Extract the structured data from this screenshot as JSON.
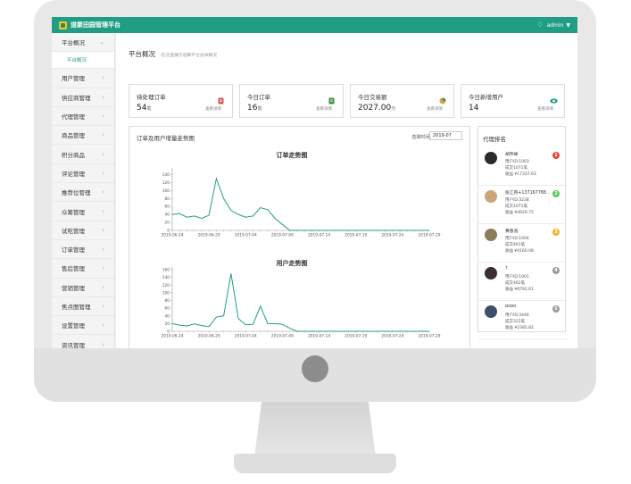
{
  "app": {
    "title": "道聚田园管理平台",
    "user": "admin"
  },
  "sidebar": {
    "items": [
      {
        "label": "平台概况",
        "expanded": true,
        "sub": "平台概况"
      },
      {
        "label": "用户管理"
      },
      {
        "label": "供应商管理"
      },
      {
        "label": "代理管理"
      },
      {
        "label": "商品管理"
      },
      {
        "label": "积分商品"
      },
      {
        "label": "评论管理"
      },
      {
        "label": "推荐位管理"
      },
      {
        "label": "众筹管理"
      },
      {
        "label": "试吃管理"
      },
      {
        "label": "订单管理"
      },
      {
        "label": "售后管理"
      },
      {
        "label": "营销管理"
      },
      {
        "label": "焦点图管理"
      },
      {
        "label": "设置管理"
      },
      {
        "label": "资讯管理"
      }
    ]
  },
  "page": {
    "title": "平台概况",
    "desc": "-在这里展示道聚平台总体概况"
  },
  "stats": [
    {
      "label": "待处理订单",
      "value": "54",
      "unit": "笔",
      "link": "查看详情",
      "icon": "order-icon",
      "color": "#d9534f"
    },
    {
      "label": "今日订单",
      "value": "16",
      "unit": "笔",
      "link": "查看详情",
      "icon": "document-icon",
      "color": "#3c8d3c"
    },
    {
      "label": "今日交易额",
      "value": "2027.00",
      "unit": "元",
      "link": "查看详情",
      "icon": "pie-icon",
      "color": "#e0a52a"
    },
    {
      "label": "今日新增用户",
      "value": "14",
      "unit": "",
      "link": "查看详情",
      "icon": "eye-icon",
      "color": "#1f9e84"
    }
  ],
  "trend": {
    "title": "订单及用户增量走势图",
    "time_label": "选择时间:",
    "time_value": "2019-07"
  },
  "chart_data": [
    {
      "type": "line",
      "title": "订单走势图",
      "x": [
        "2019-06-24",
        "2019-06-25",
        "2019-06-26",
        "2019-06-27",
        "2019-06-28",
        "2019-06-29",
        "2019-06-30",
        "2019-07-01",
        "2019-07-02",
        "2019-07-03",
        "2019-07-04",
        "2019-07-05",
        "2019-07-06",
        "2019-07-07",
        "2019-07-08",
        "2019-07-09",
        "2019-07-10",
        "2019-07-11",
        "2019-07-12",
        "2019-07-13",
        "2019-07-14",
        "2019-07-15",
        "2019-07-16",
        "2019-07-17",
        "2019-07-18",
        "2019-07-19",
        "2019-07-20",
        "2019-07-21",
        "2019-07-22",
        "2019-07-23",
        "2019-07-24",
        "2019-07-25",
        "2019-07-26",
        "2019-07-27",
        "2019-07-28",
        "2019-07-29"
      ],
      "values": [
        40,
        42,
        33,
        36,
        30,
        38,
        130,
        80,
        50,
        40,
        33,
        36,
        57,
        52,
        30,
        15,
        0,
        0,
        0,
        0,
        0,
        0,
        0,
        0,
        0,
        0,
        0,
        0,
        0,
        0,
        0,
        0,
        0,
        0,
        0,
        0
      ],
      "xticks": [
        "2019-06-24",
        "2019-06-29",
        "2019-07-04",
        "2019-07-09",
        "2019-07-14",
        "2019-07-19",
        "2019-07-24",
        "2019-07-29"
      ],
      "yticks": [
        0,
        20,
        40,
        60,
        80,
        100,
        120,
        140
      ],
      "ylim": [
        0,
        150
      ],
      "color": "#1f9e84"
    },
    {
      "type": "line",
      "title": "用户走势图",
      "x": [
        "2019-06-24",
        "2019-06-25",
        "2019-06-26",
        "2019-06-27",
        "2019-06-28",
        "2019-06-29",
        "2019-06-30",
        "2019-07-01",
        "2019-07-02",
        "2019-07-03",
        "2019-07-04",
        "2019-07-05",
        "2019-07-06",
        "2019-07-07",
        "2019-07-08",
        "2019-07-09",
        "2019-07-10",
        "2019-07-11",
        "2019-07-12",
        "2019-07-13",
        "2019-07-14",
        "2019-07-15",
        "2019-07-16",
        "2019-07-17",
        "2019-07-18",
        "2019-07-19",
        "2019-07-20",
        "2019-07-21",
        "2019-07-22",
        "2019-07-23",
        "2019-07-24",
        "2019-07-25",
        "2019-07-26",
        "2019-07-27",
        "2019-07-28",
        "2019-07-29"
      ],
      "values": [
        20,
        16,
        14,
        19,
        15,
        12,
        37,
        40,
        150,
        33,
        17,
        18,
        65,
        20,
        20,
        18,
        8,
        0,
        0,
        0,
        0,
        0,
        0,
        0,
        0,
        0,
        0,
        0,
        0,
        0,
        0,
        0,
        0,
        0,
        0,
        0
      ],
      "xticks": [
        "2019-06-24",
        "2019-06-29",
        "2019-07-04",
        "2019-07-09",
        "2019-07-14",
        "2019-07-19",
        "2019-07-24",
        "2019-07-29"
      ],
      "yticks": [
        0,
        20,
        40,
        60,
        80,
        100,
        120,
        140,
        160
      ],
      "ylim": [
        0,
        160
      ],
      "color": "#1f9e84"
    }
  ],
  "ranking": {
    "title": "代理排名",
    "items": [
      {
        "name": "胡伟峰",
        "id": "用户ID:1003",
        "deals": "成交1071笔",
        "income": "收益 ¥17337.63",
        "badge": "1",
        "badge_color": "#e8483a",
        "avatar_color": "#2b2b2b"
      },
      {
        "name": "张江燕+137167788…",
        "id": "用户ID:3238",
        "deals": "成交1071笔",
        "income": "收益 ¥4926.75",
        "badge": "2",
        "badge_color": "#5bc85b",
        "avatar_color": "#c9a77a"
      },
      {
        "name": "黄春浩",
        "id": "用户ID:1004",
        "deals": "成交461笔",
        "income": "收益 ¥4160.08",
        "badge": "3",
        "badge_color": "#f0b429",
        "avatar_color": "#8a7d5c"
      },
      {
        "name": "Y",
        "id": "用户ID:1001",
        "deals": "成交462笔",
        "income": "收益 ¥8792.61",
        "badge": "4",
        "badge_color": "#9a9a9a",
        "avatar_color": "#3a2e2e"
      },
      {
        "name": "Bobo",
        "id": "用户ID:3446",
        "deals": "成交322笔",
        "income": "收益 ¥2385.82",
        "badge": "5",
        "badge_color": "#9a9a9a",
        "avatar_color": "#3d4f6a"
      }
    ]
  }
}
